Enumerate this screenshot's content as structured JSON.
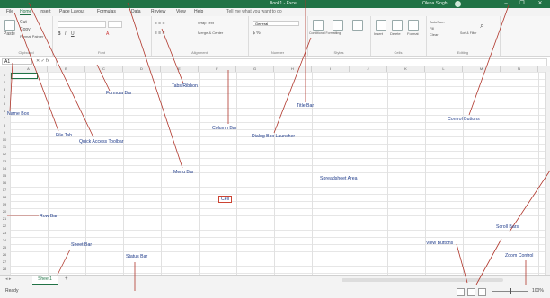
{
  "window": {
    "title": "Book1 - Excel",
    "user": "Olena Singh",
    "controls": [
      "–",
      "❐",
      "✕"
    ]
  },
  "tabs": [
    {
      "label": "File",
      "selected": false
    },
    {
      "label": "Home",
      "selected": true
    },
    {
      "label": "Insert",
      "selected": false
    },
    {
      "label": "Page Layout",
      "selected": false
    },
    {
      "label": "Formulas",
      "selected": false
    },
    {
      "label": "Data",
      "selected": false
    },
    {
      "label": "Review",
      "selected": false
    },
    {
      "label": "View",
      "selected": false
    },
    {
      "label": "Help",
      "selected": false
    }
  ],
  "tell_me": "Tell me what you want to do",
  "ribbon": {
    "groups": [
      "Clipboard",
      "Font",
      "Alignment",
      "Number",
      "Styles",
      "Cells",
      "Editing"
    ],
    "clipboard": {
      "paste": "Paste",
      "cut": "Cut",
      "copy": "Copy",
      "format_painter": "Format Painter"
    },
    "alignment": {
      "wrap": "Wrap Text",
      "merge": "Merge & Center"
    },
    "number": {
      "format": "General"
    },
    "styles": {
      "conditional": "Conditional Formatting",
      "table": "Format as Table",
      "cell_styles": "Cell Styles"
    },
    "cells": {
      "insert": "Insert",
      "delete": "Delete",
      "format": "Format"
    },
    "editing": {
      "autosum": "AutoSum",
      "fill": "Fill",
      "clear": "Clear",
      "sort": "Sort & Filter",
      "find": "Find & Select"
    }
  },
  "name_box": "A1",
  "sheet": {
    "tab_label": "Sheet1",
    "add": "+"
  },
  "status": {
    "ready": "Ready",
    "zoom": "100%"
  },
  "annotations": {
    "name_box": "Name Box",
    "file_tab": "File Tab",
    "quick_access": "Quick Access Toolbar",
    "formula_bar": "Formula Bar",
    "tabs_ribbon": "Tabs/Ribbon",
    "menu_bar": "Menu Bar",
    "column_bar": "Column Bar",
    "dialog_box_launcher": "Dialog Box Launcher",
    "title_bar": "Title Bar",
    "control_buttons": "Control Buttons",
    "cell": "Cell",
    "spreadsheet_area": "Spreadsheet Area",
    "row_bar": "Row Bar",
    "sheet_bar": "Sheet Bar",
    "status_bar": "Status Bar",
    "view_buttons": "View Buttons",
    "scroll_bars": "Scroll Bars",
    "zoom_control": "Zoom Control"
  }
}
